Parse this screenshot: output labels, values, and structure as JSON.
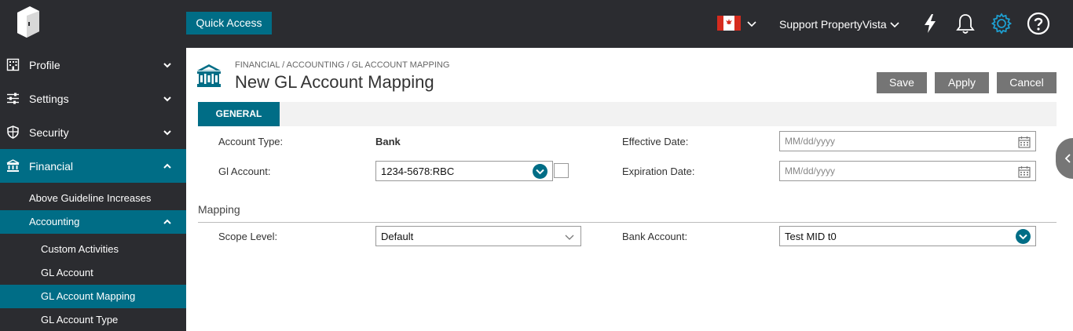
{
  "header": {
    "quick_access_label": "Quick Access",
    "user_name": "Support PropertyVista",
    "colors": {
      "bar": "#2b2c30",
      "accent": "#006d86"
    },
    "icons": [
      "logo-icon",
      "canada-flag-icon",
      "lightning-icon",
      "bell-icon",
      "gear-icon",
      "help-icon"
    ]
  },
  "sidebar": {
    "items": [
      {
        "label": "Profile",
        "icon": "building-icon"
      },
      {
        "label": "Settings",
        "icon": "sliders-icon"
      },
      {
        "label": "Security",
        "icon": "shield-icon"
      },
      {
        "label": "Financial",
        "icon": "bank-icon"
      }
    ],
    "financial_children": [
      {
        "label": "Above Guideline Increases"
      },
      {
        "label": "Accounting"
      }
    ],
    "accounting_children": [
      {
        "label": "Custom Activities"
      },
      {
        "label": "GL Account"
      },
      {
        "label": "GL Account Mapping"
      },
      {
        "label": "GL Account Type"
      }
    ]
  },
  "page": {
    "breadcrumb": "FINANCIAL / ACCOUNTING / GL ACCOUNT MAPPING",
    "title": "New GL Account Mapping",
    "buttons": {
      "save": "Save",
      "apply": "Apply",
      "cancel": "Cancel"
    },
    "tab_general": "GENERAL"
  },
  "form": {
    "account_type_label": "Account Type:",
    "account_type_value": "Bank",
    "gl_account_label": "Gl Account:",
    "gl_account_value": "1234-5678:RBC",
    "effective_date_label": "Effective Date:",
    "effective_date_placeholder": "MM/dd/yyyy",
    "expiration_date_label": "Expiration Date:",
    "expiration_date_placeholder": "MM/dd/yyyy"
  },
  "mapping": {
    "section_title": "Mapping",
    "scope_level_label": "Scope Level:",
    "scope_level_value": "Default",
    "bank_account_label": "Bank Account:",
    "bank_account_value": "Test MID t0"
  }
}
